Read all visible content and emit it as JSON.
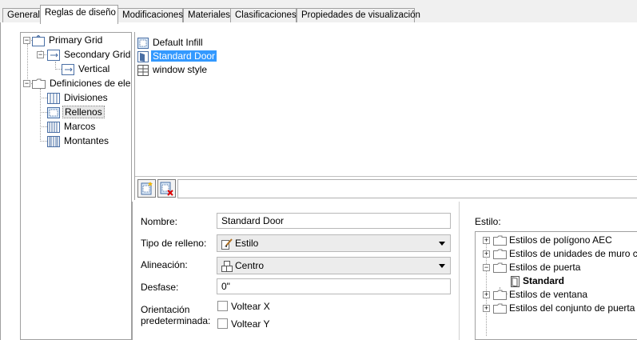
{
  "tabs": [
    {
      "label": "General"
    },
    {
      "label": "Reglas de diseño"
    },
    {
      "label": "Modificaciones"
    },
    {
      "label": "Materiales"
    },
    {
      "label": "Clasificaciones"
    },
    {
      "label": "Propiedades de visualización"
    }
  ],
  "active_tab": "Reglas de diseño",
  "tree": {
    "primary_grid": "Primary Grid",
    "secondary_grid": "Secondary Grid",
    "vertical": "Vertical",
    "definitions": "Definiciones de ele",
    "divisions": "Divisiones",
    "infills": "Rellenos",
    "frames": "Marcos",
    "mullions": "Montantes"
  },
  "style_list": {
    "items": [
      "Default Infill",
      "Standard Door",
      "window style"
    ],
    "selected": "Standard Door"
  },
  "properties": {
    "name_label": "Nombre:",
    "name_value": "Standard Door",
    "infill_type_label": "Tipo de relleno:",
    "infill_type_value": "Estilo",
    "alignment_label": "Alineación:",
    "alignment_value": "Centro",
    "offset_label": "Desfase:",
    "offset_value": "0\"",
    "orientation_label_1": "Orientación",
    "orientation_label_2": "predeterminada:",
    "flip_x": "Voltear X",
    "flip_y": "Voltear Y",
    "style_label": "Estilo:"
  },
  "style_tree": {
    "items": [
      "Estilos de polígono AEC",
      "Estilos de unidades de muro cc",
      "Estilos de puerta",
      "Standard",
      "Estilos de ventana",
      "Estilos del conjunto de puerta"
    ]
  },
  "colors": {
    "selection": "#3399ff",
    "border": "#a0a0a0",
    "window_bg": "#f0f0f0"
  }
}
